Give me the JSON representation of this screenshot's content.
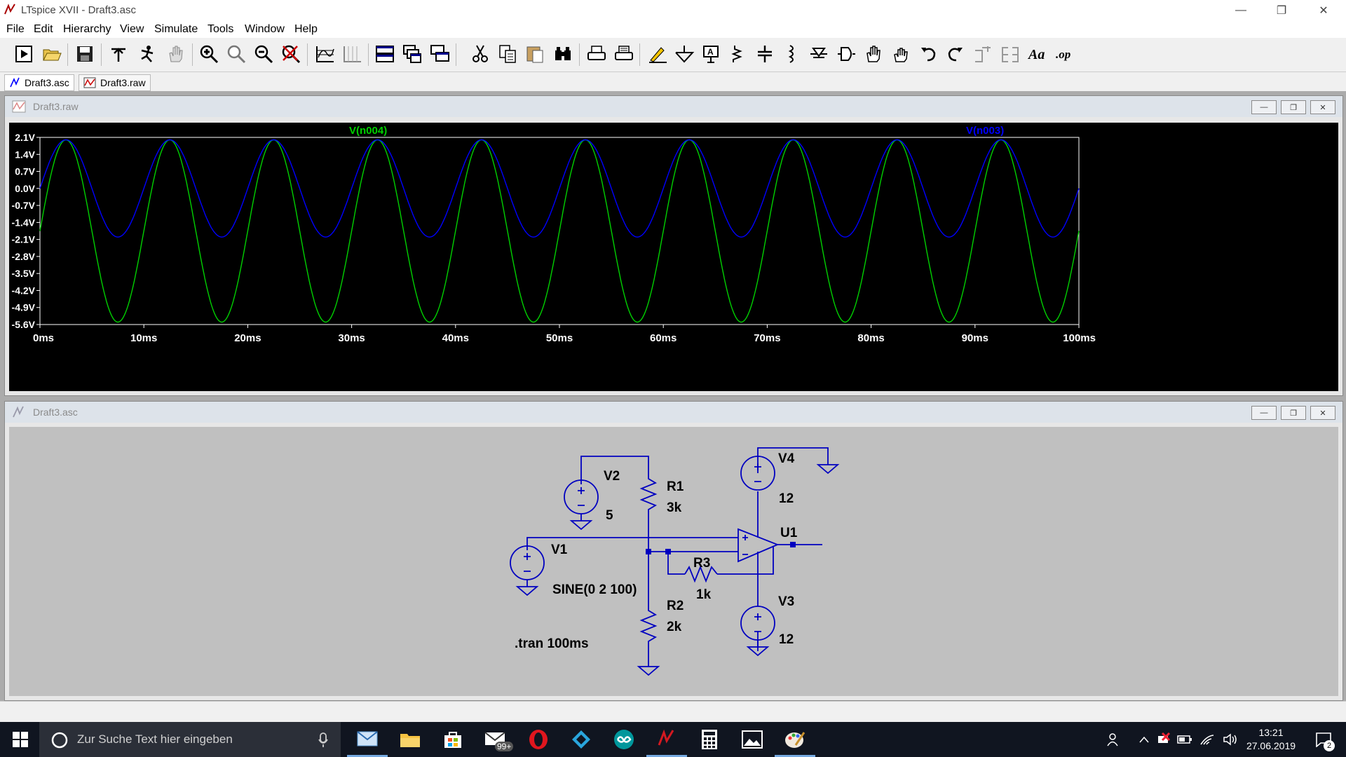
{
  "window": {
    "title": "LTspice XVII - Draft3.asc"
  },
  "menu": [
    {
      "label": "File",
      "hot": "F"
    },
    {
      "label": "Edit",
      "hot": "E"
    },
    {
      "label": "Hierarchy",
      "hot": "i"
    },
    {
      "label": "View",
      "hot": "V"
    },
    {
      "label": "Simulate",
      "hot": "S"
    },
    {
      "label": "Tools",
      "hot": "T"
    },
    {
      "label": "Window",
      "hot": "W"
    },
    {
      "label": "Help",
      "hot": "H"
    }
  ],
  "toolbar_icons": [
    "run-icon",
    "open-icon",
    "save-icon",
    "control-panel-icon",
    "probe-icon",
    "pan-hand-icon",
    "zoom-in-icon",
    "zoom-fit-icon",
    "zoom-out-icon",
    "zoom-cancel-icon",
    "autorange-icon",
    "grid-icon",
    "tile-horizontal-icon",
    "cascade-icon",
    "tile-vertical-icon",
    "cut-icon",
    "copy-icon",
    "paste-icon",
    "find-icon",
    "print-icon",
    "print-preview-icon",
    "wire-icon",
    "ground-icon",
    "label-net-icon",
    "resistor-icon",
    "capacitor-icon",
    "inductor-icon",
    "diode-icon",
    "component-icon",
    "move-icon",
    "drag-icon",
    "undo-icon",
    "redo-icon",
    "rotate-icon",
    "mirror-icon",
    "text-icon",
    "spice-directive-icon"
  ],
  "tabs": [
    {
      "label": "Draft3.asc",
      "icon": "schematic-icon",
      "active": true
    },
    {
      "label": "Draft3.raw",
      "icon": "waveform-icon",
      "active": false
    }
  ],
  "waveform_window": {
    "title": "Draft3.raw",
    "trace_labels": [
      {
        "name": "V(n004)",
        "color": "#00d000"
      },
      {
        "name": "V(n003)",
        "color": "#0000ff"
      }
    ]
  },
  "chart_data": {
    "type": "line",
    "title": "",
    "xlabel": "",
    "ylabel": "",
    "x_ticks": [
      "0ms",
      "10ms",
      "20ms",
      "30ms",
      "40ms",
      "50ms",
      "60ms",
      "70ms",
      "80ms",
      "90ms",
      "100ms"
    ],
    "y_ticks": [
      "2.1V",
      "1.4V",
      "0.7V",
      "0.0V",
      "-0.7V",
      "-1.4V",
      "-2.1V",
      "-2.8V",
      "-3.5V",
      "-4.2V",
      "-4.9V",
      "-5.6V"
    ],
    "xlim_ms": [
      0,
      100
    ],
    "ylim_V": [
      -5.6,
      2.1
    ],
    "background": "#000000",
    "series": [
      {
        "name": "V(n004)",
        "color": "#00d000",
        "kind": "sine",
        "offset_V": -1.75,
        "amplitude_V": 3.75,
        "frequency_Hz": 100,
        "phase_deg": 0
      },
      {
        "name": "V(n003)",
        "color": "#0000ff",
        "kind": "sine",
        "offset_V": 0.0,
        "amplitude_V": 2.0,
        "frequency_Hz": 100,
        "phase_deg": 0
      }
    ]
  },
  "schematic_window": {
    "title": "Draft3.asc",
    "components": {
      "v1": {
        "name": "V1",
        "value": "SINE(0 2 100)"
      },
      "v2": {
        "name": "V2",
        "value": "5"
      },
      "v3": {
        "name": "V3",
        "value": "12"
      },
      "v4": {
        "name": "V4",
        "value": "12"
      },
      "r1": {
        "name": "R1",
        "value": "3k"
      },
      "r2": {
        "name": "R2",
        "value": "2k"
      },
      "r3": {
        "name": "R3",
        "value": "1k"
      },
      "u1": {
        "name": "U1"
      }
    },
    "directive": ".tran 100ms"
  },
  "taskbar": {
    "search_placeholder": "Zur Suche Text hier eingeben",
    "mail_badge": "99+",
    "apps": [
      "outlook-icon",
      "file-explorer-icon",
      "store-icon",
      "mail-icon",
      "opera-icon",
      "kodi-icon",
      "arduino-icon",
      "ltspice-icon",
      "calculator-icon",
      "photos-icon",
      "paint-icon"
    ],
    "time": "13:21",
    "date": "27.06.2019",
    "notifications": "2"
  },
  "colors": {
    "wire": "#0000c0",
    "schematic_bg": "#c0c0c0",
    "plot_bg": "#000000",
    "grid": "#ffffff"
  }
}
